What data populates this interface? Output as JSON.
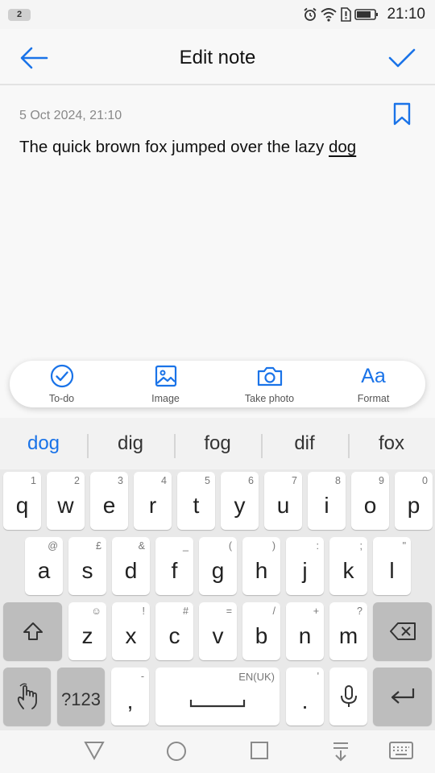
{
  "status_bar": {
    "notification_count": "2",
    "time": "21:10"
  },
  "header": {
    "title": "Edit note"
  },
  "note": {
    "date": "5 Oct 2024, 21:10",
    "text_main": "The quick brown fox jumped over the lazy ",
    "text_underlined": "dog"
  },
  "tools": [
    {
      "label": "To-do",
      "icon": "checkmark-circle-icon"
    },
    {
      "label": "Image",
      "icon": "image-icon"
    },
    {
      "label": "Take photo",
      "icon": "camera-icon"
    },
    {
      "label": "Format",
      "icon": "format-text-icon",
      "glyph": "Aa"
    }
  ],
  "keyboard": {
    "suggestions": [
      "dog",
      "dig",
      "fog",
      "dif",
      "fox"
    ],
    "row1": [
      {
        "main": "q",
        "alt": "1"
      },
      {
        "main": "w",
        "alt": "2"
      },
      {
        "main": "e",
        "alt": "3"
      },
      {
        "main": "r",
        "alt": "4"
      },
      {
        "main": "t",
        "alt": "5"
      },
      {
        "main": "y",
        "alt": "6"
      },
      {
        "main": "u",
        "alt": "7"
      },
      {
        "main": "i",
        "alt": "8"
      },
      {
        "main": "o",
        "alt": "9"
      },
      {
        "main": "p",
        "alt": "0"
      }
    ],
    "row2": [
      {
        "main": "a",
        "alt": "@"
      },
      {
        "main": "s",
        "alt": "£"
      },
      {
        "main": "d",
        "alt": "&"
      },
      {
        "main": "f",
        "alt": "_"
      },
      {
        "main": "g",
        "alt": "("
      },
      {
        "main": "h",
        "alt": ")"
      },
      {
        "main": "j",
        "alt": ":"
      },
      {
        "main": "k",
        "alt": ";"
      },
      {
        "main": "l",
        "alt": "\""
      }
    ],
    "row3": [
      {
        "main": "z",
        "alt": "☺"
      },
      {
        "main": "x",
        "alt": "!"
      },
      {
        "main": "c",
        "alt": "#"
      },
      {
        "main": "v",
        "alt": "="
      },
      {
        "main": "b",
        "alt": "/"
      },
      {
        "main": "n",
        "alt": "+"
      },
      {
        "main": "m",
        "alt": "?"
      }
    ],
    "symbols_label": "?123",
    "comma": {
      "main": ",",
      "alt": "-"
    },
    "space_language": "EN(UK)",
    "period": {
      "main": ".",
      "alt": "'"
    }
  },
  "colors": {
    "accent": "#1a73e8"
  }
}
